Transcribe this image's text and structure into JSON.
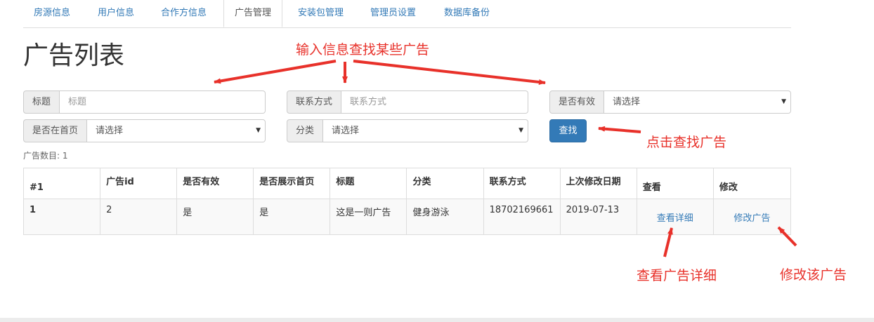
{
  "nav": {
    "tabs": [
      {
        "label": "房源信息",
        "active": false
      },
      {
        "label": "用户信息",
        "active": false
      },
      {
        "label": "合作方信息",
        "active": false
      },
      {
        "label": "广告管理",
        "active": true
      },
      {
        "label": "安装包管理",
        "active": false
      },
      {
        "label": "管理员设置",
        "active": false
      },
      {
        "label": "数据库备份",
        "active": false
      }
    ]
  },
  "page": {
    "title": "广告列表"
  },
  "filters": {
    "title": {
      "label": "标题",
      "placeholder": "标题"
    },
    "contact": {
      "label": "联系方式",
      "placeholder": "联系方式"
    },
    "valid": {
      "label": "是否有效",
      "value": "请选择"
    },
    "on_home": {
      "label": "是否在首页",
      "value": "请选择"
    },
    "category": {
      "label": "分类",
      "value": "请选择"
    },
    "search_button": "查找"
  },
  "count_text": "广告数目: 1",
  "table": {
    "headers": [
      "#1",
      "广告id",
      "是否有效",
      "是否展示首页",
      "标题",
      "分类",
      "联系方式",
      "上次修改日期",
      "查看",
      "修改"
    ],
    "rows": [
      {
        "index": "1",
        "id": "2",
        "valid": "是",
        "home": "是",
        "title": "这是一则广告",
        "category": "健身游泳",
        "contact": "18702169661",
        "modified": "2019-07-13",
        "view": "查看详细",
        "edit": "修改广告"
      }
    ]
  },
  "annotations": {
    "input_hint": "输入信息查找某些广告",
    "search_hint": "点击查找广告",
    "view_hint": "查看广告详细",
    "edit_hint": "修改该广告"
  },
  "colors": {
    "accent": "#337ab7",
    "annotation": "#e8312a"
  }
}
